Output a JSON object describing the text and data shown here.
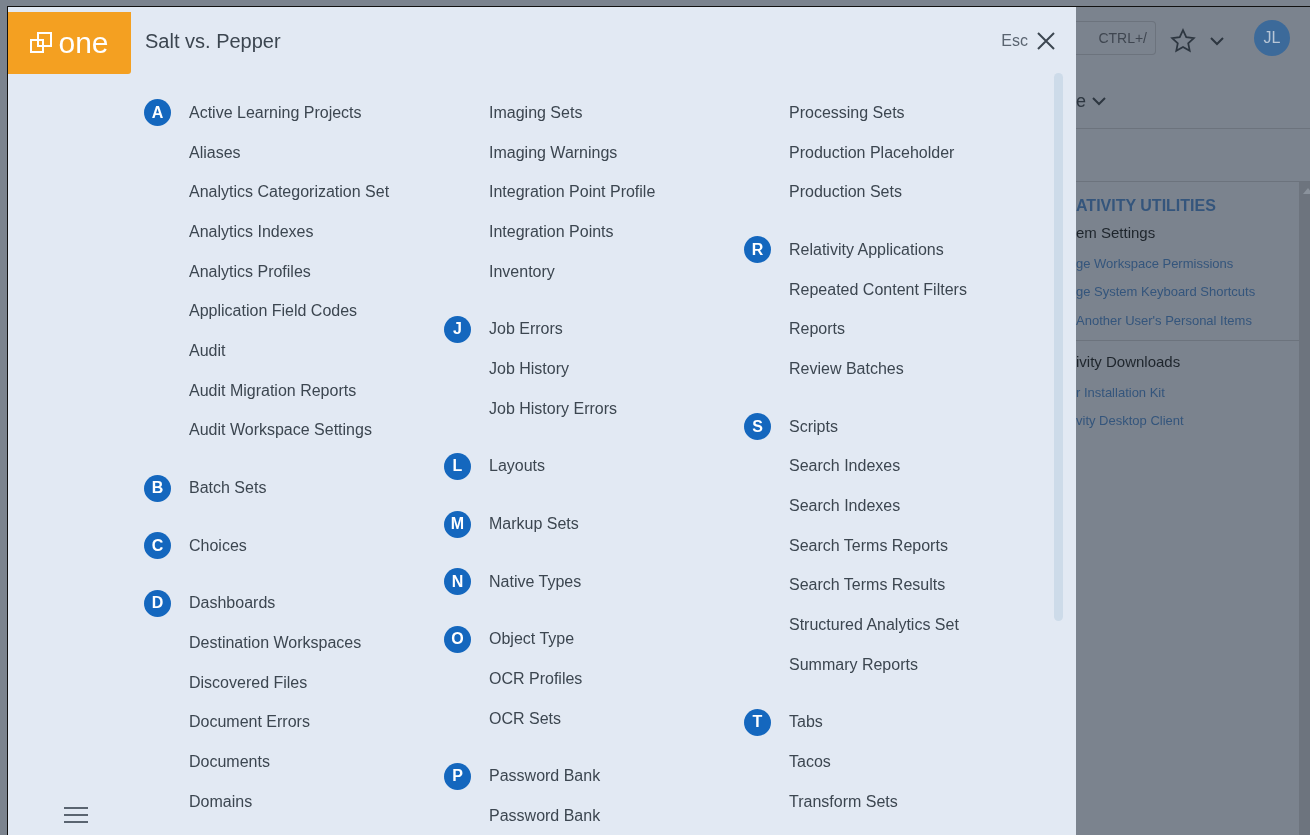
{
  "header": {
    "logo_text": "one",
    "title": "Salt vs. Pepper",
    "esc_label": "Esc"
  },
  "index_columns": [
    {
      "groups": [
        {
          "letter": "A",
          "items": [
            "Active Learning Projects",
            "Aliases",
            "Analytics Categorization Set",
            "Analytics Indexes",
            "Analytics Profiles",
            "Application Field Codes",
            "Audit",
            "Audit Migration Reports",
            "Audit Workspace Settings"
          ]
        },
        {
          "letter": "B",
          "items": [
            "Batch Sets"
          ]
        },
        {
          "letter": "C",
          "items": [
            "Choices"
          ]
        },
        {
          "letter": "D",
          "items": [
            "Dashboards",
            "Destination Workspaces",
            "Discovered Files",
            "Document Errors",
            "Documents",
            "Domains"
          ]
        }
      ]
    },
    {
      "groups": [
        {
          "items": [
            "Imaging Sets",
            "Imaging Warnings",
            "Integration Point Profile",
            "Integration Points",
            "Inventory"
          ]
        },
        {
          "letter": "J",
          "items": [
            "Job Errors",
            "Job History",
            "Job History Errors"
          ]
        },
        {
          "letter": "L",
          "items": [
            "Layouts"
          ]
        },
        {
          "letter": "M",
          "items": [
            "Markup Sets"
          ]
        },
        {
          "letter": "N",
          "items": [
            "Native Types"
          ]
        },
        {
          "letter": "O",
          "items": [
            "Object Type",
            "OCR Profiles",
            "OCR Sets"
          ]
        },
        {
          "letter": "P",
          "items": [
            "Password Bank",
            "Password Bank"
          ]
        }
      ]
    },
    {
      "groups": [
        {
          "items": [
            "Processing Sets",
            "Production Placeholder",
            "Production Sets"
          ]
        },
        {
          "letter": "R",
          "items": [
            "Relativity Applications",
            "Repeated Content Filters",
            "Reports",
            "Review Batches"
          ]
        },
        {
          "letter": "S",
          "items": [
            "Scripts",
            "Search Indexes",
            "Search Indexes",
            "Search Terms Reports",
            "Search Terms Results",
            "Structured Analytics Set",
            "Summary Reports"
          ]
        },
        {
          "letter": "T",
          "items": [
            "Tabs",
            "Tacos",
            "Transform Sets"
          ]
        }
      ]
    }
  ],
  "background": {
    "search_shortcut": "CTRL+/",
    "avatar_initials": "JL",
    "menu_fragment": "e",
    "utilities": {
      "heading": "ATIVITY UTILITIES",
      "sections": [
        {
          "title": "em Settings",
          "links": [
            "ge Workspace Permissions",
            "ge System Keyboard Shortcuts",
            "Another User's Personal Items"
          ]
        },
        {
          "title": "ivity Downloads",
          "links": [
            "r Installation Kit",
            "vity Desktop Client"
          ]
        }
      ]
    }
  }
}
